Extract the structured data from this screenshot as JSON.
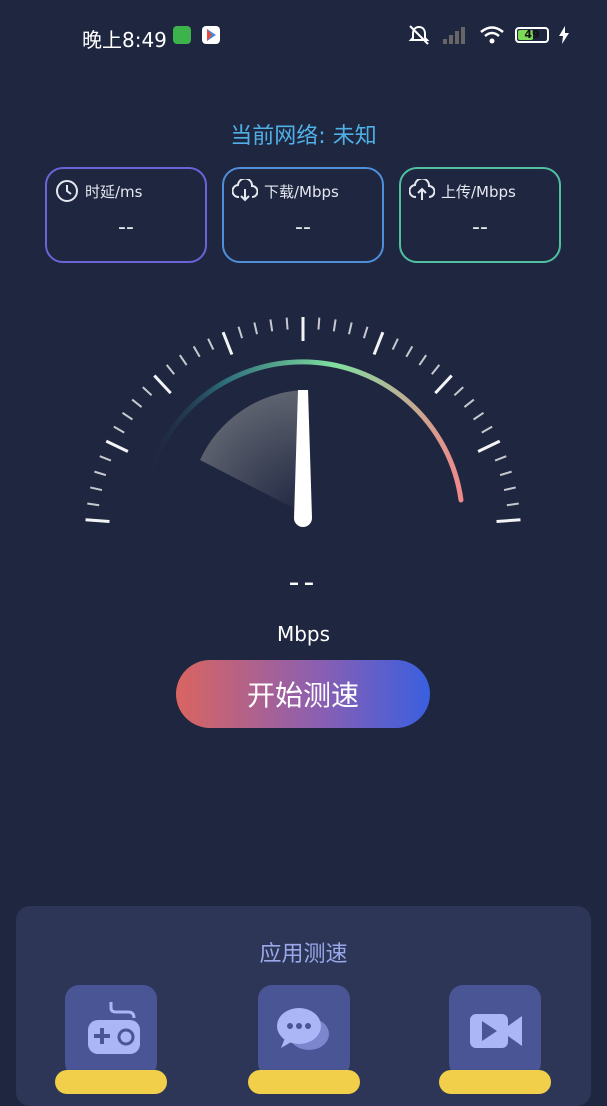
{
  "status_bar": {
    "time": "晚上8:49",
    "battery": "49"
  },
  "network_label": "当前网络: 未知",
  "metrics": [
    {
      "label": "时延/ms",
      "value": "--",
      "icon": "clock-icon"
    },
    {
      "label": "下载/Mbps",
      "value": "--",
      "icon": "download-icon"
    },
    {
      "label": "上传/Mbps",
      "value": "--",
      "icon": "upload-icon"
    }
  ],
  "speed": {
    "value": "--",
    "unit": "Mbps"
  },
  "start_button": "开始测速",
  "app_test": {
    "title": "应用测速",
    "apps": [
      {
        "icon": "gamepad-icon"
      },
      {
        "icon": "chat-icon"
      },
      {
        "icon": "video-icon"
      }
    ]
  },
  "colors": {
    "background": "#1f2640",
    "accent_blue": "#4fb0e6",
    "panel": "#2e3658",
    "button_start": "#d96560",
    "button_end": "#3a5fe0"
  }
}
